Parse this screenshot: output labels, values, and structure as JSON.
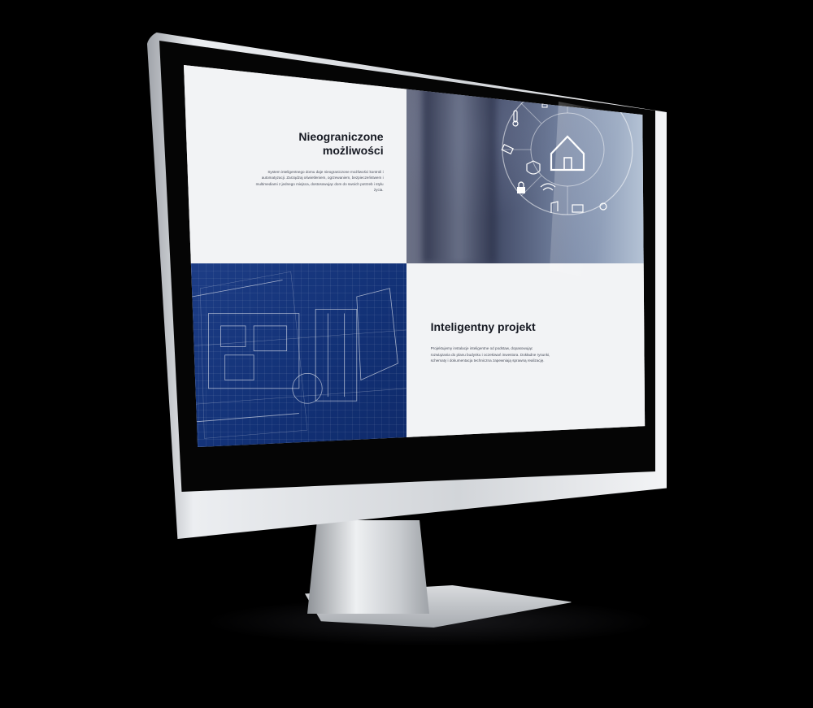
{
  "screen": {
    "section1": {
      "title_line1": "Nieograniczone",
      "title_line2": "możliwości",
      "body": "System inteligentnego domu daje nieograniczone możliwości kontroli i automatyzacji. Zarządzaj oświetleniem, ogrzewaniem, bezpieczeństwem i multimediami z jednego miejsca, dostosowując dom do swoich potrzeb i stylu życia."
    },
    "section2": {
      "title": "Inteligentny projekt",
      "body": "Projektujemy instalacje inteligentne od podstaw, dopasowując rozwiązania do planu budynku i oczekiwań inwestora. Dokładne rysunki, schematy i dokumentacja techniczna zapewniają sprawną realizację."
    },
    "icons": [
      "thermometer-icon",
      "lightbulb-icon",
      "camera-icon",
      "shield-icon",
      "lock-icon",
      "wifi-icon",
      "music-icon",
      "tv-icon",
      "home-icon",
      "settings-icon"
    ],
    "colors": {
      "blueprint": "#123176",
      "text_panel": "#f2f3f5",
      "heading": "#161922"
    }
  }
}
